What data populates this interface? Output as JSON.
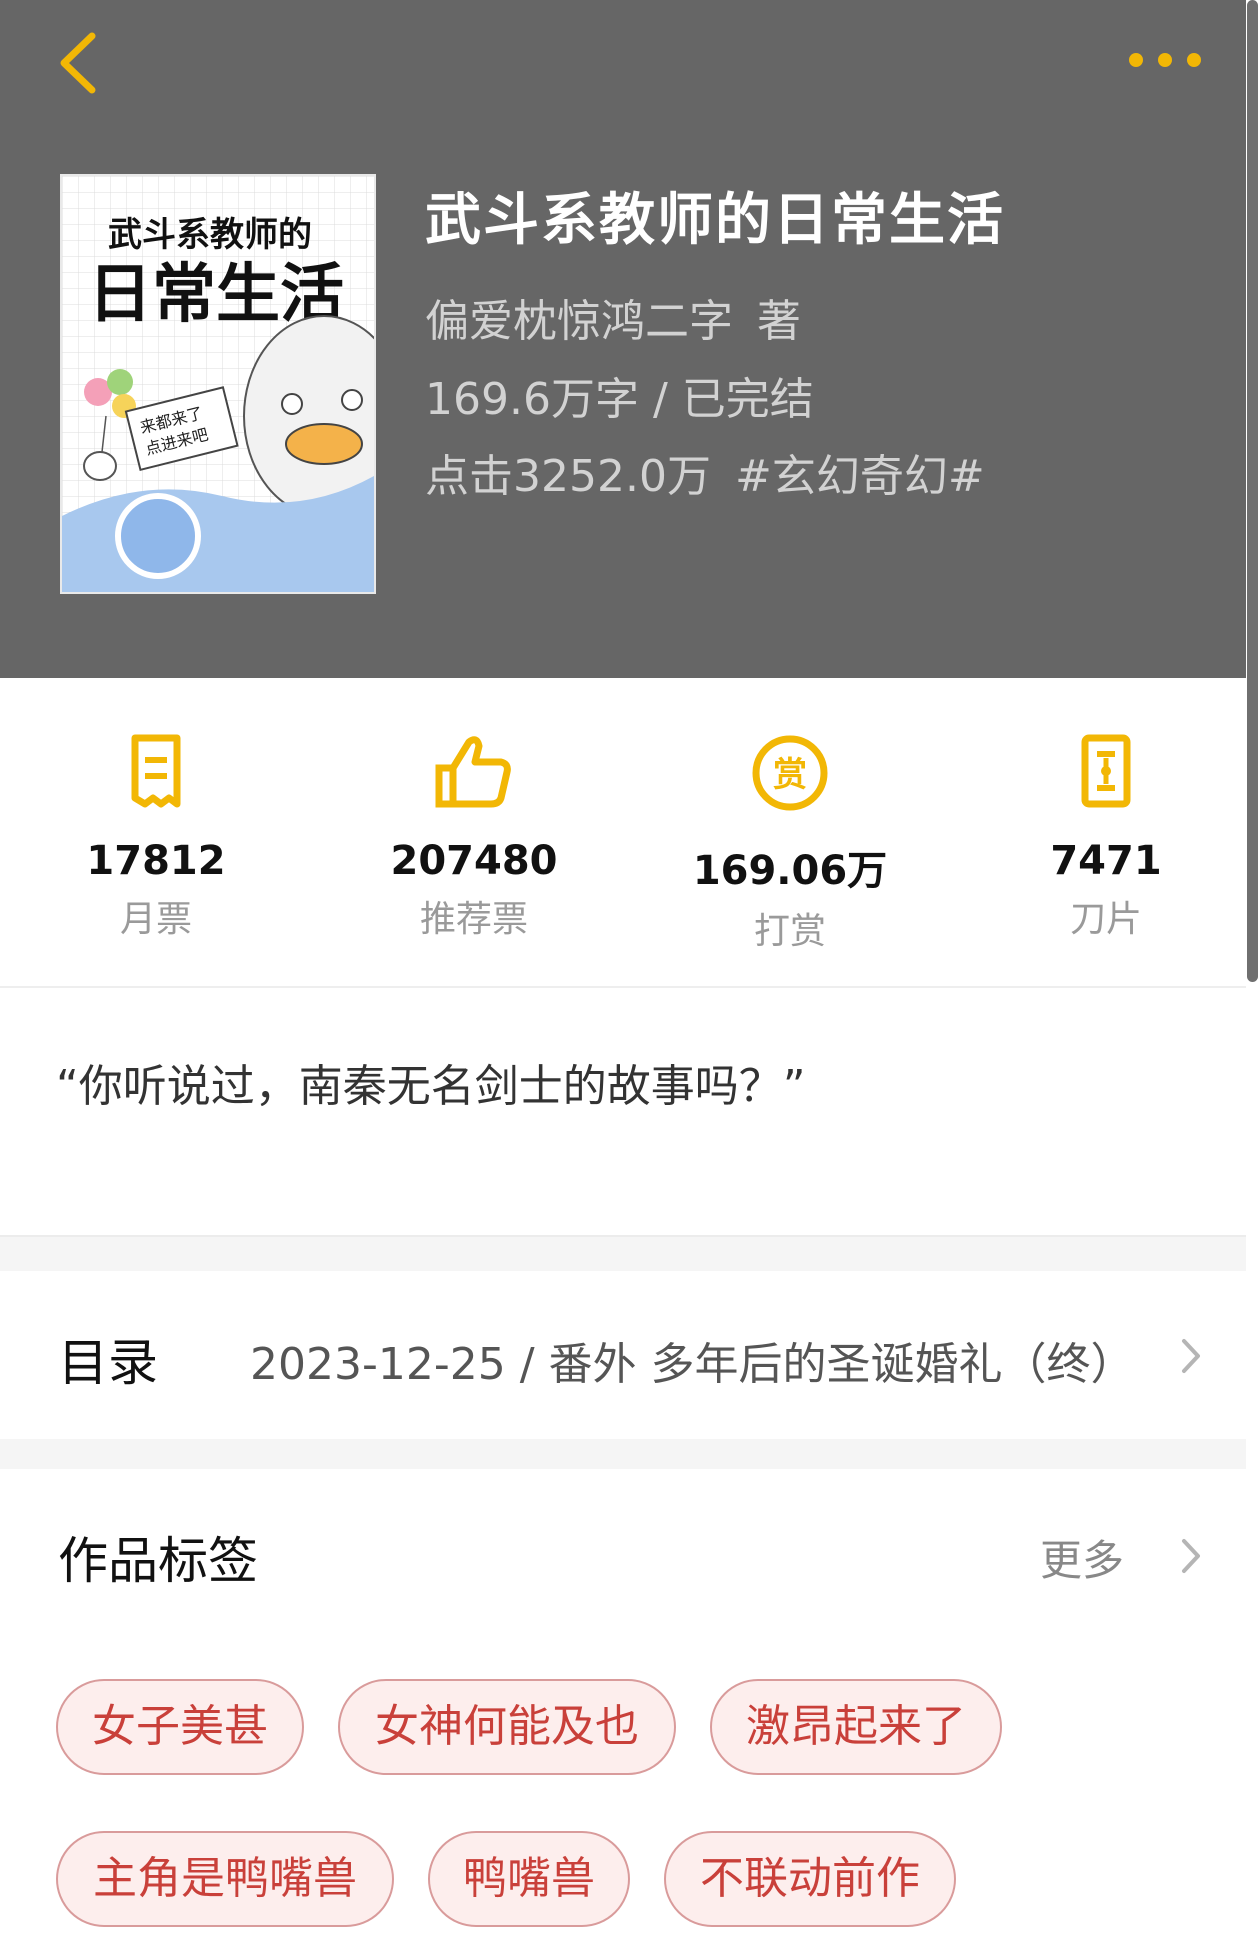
{
  "header": {
    "back_icon": "chevron-left-icon",
    "more_icon": "more-dots-icon",
    "accent_color": "#F2B705"
  },
  "book": {
    "title": "武斗系教师的日常生活",
    "author": "偏爱枕惊鸿二字",
    "author_suffix": "著",
    "word_count": "169.6万字",
    "status": "已完结",
    "clicks": "点击3252.0万",
    "genre": "#玄幻奇幻#"
  },
  "cover": {
    "title_line1": "武斗系教师的",
    "title_line2": "日常生活",
    "sign_line1": "来都来了",
    "sign_line2": "点进来吧"
  },
  "stats": [
    {
      "icon": "ticket-icon",
      "value": "17812",
      "label": "月票"
    },
    {
      "icon": "thumbs-up-icon",
      "value": "207480",
      "label": "推荐票"
    },
    {
      "icon": "reward-coin-icon",
      "value": "169.06万",
      "label": "打赏"
    },
    {
      "icon": "blade-card-icon",
      "value": "7471",
      "label": "刀片"
    }
  ],
  "intro": {
    "text": "“你听说过，南秦无名剑士的故事吗？”"
  },
  "catalog": {
    "title": "目录",
    "latest": "2023-12-25 / 番外  多年后的圣诞婚礼（终）"
  },
  "tags": {
    "title": "作品标签",
    "more_label": "更多",
    "items": [
      "女子美甚",
      "女神何能及也",
      "激昂起来了",
      "主角是鸭嘴兽",
      "鸭嘴兽",
      "不联动前作"
    ]
  }
}
